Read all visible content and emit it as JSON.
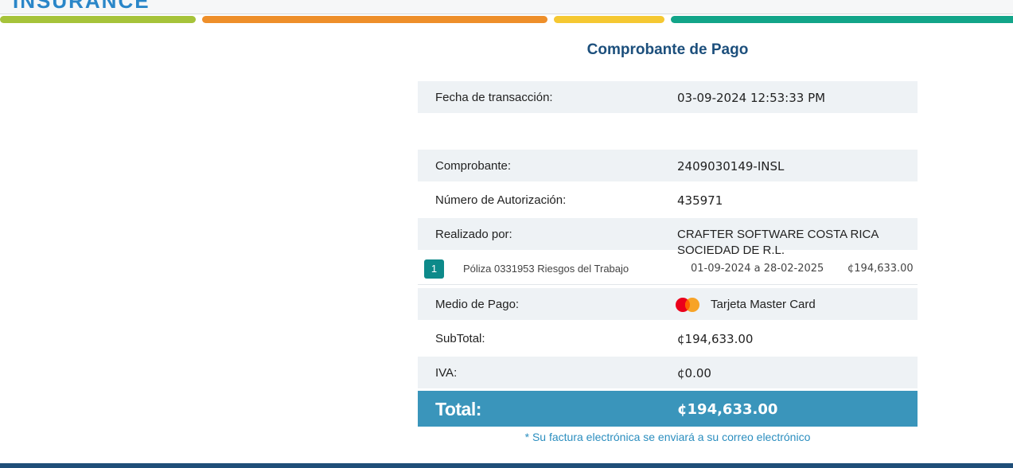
{
  "header": {
    "logo_text": "INSURANCE"
  },
  "colors": {
    "green": "#a6c33a",
    "orange": "#ee8f2a",
    "yellow": "#f5c832",
    "teal": "#12a589",
    "title": "#1c4f7c",
    "total_bg": "#3a95bb",
    "note": "#2b8ebf"
  },
  "receipt": {
    "title": "Comprobante de Pago",
    "transaction_date": {
      "label": "Fecha de transacción:",
      "value": "03-09-2024 12:53:33 PM"
    },
    "voucher": {
      "label": "Comprobante:",
      "value": "2409030149-INSL"
    },
    "authorization": {
      "label": "Número de Autorización:",
      "value": "435971"
    },
    "made_by": {
      "label": "Realizado por:",
      "value": "CRAFTER SOFTWARE COSTA RICA SOCIEDAD DE R.L."
    },
    "item": {
      "number": "1",
      "description": "Póliza 0331953 Riesgos del Trabajo",
      "period": "01-09-2024 a 28-02-2025",
      "amount": "¢194,633.00"
    },
    "payment_method": {
      "label": "Medio de Pago:",
      "value": "Tarjeta Master Card",
      "icon": "mastercard-icon"
    },
    "subtotal": {
      "label": "SubTotal:",
      "value": "¢194,633.00"
    },
    "tax": {
      "label": "IVA:",
      "value": "¢0.00"
    },
    "total": {
      "label": "Total:",
      "value": "¢194,633.00"
    },
    "note": "* Su factura electrónica se enviará a su correo electrónico"
  }
}
